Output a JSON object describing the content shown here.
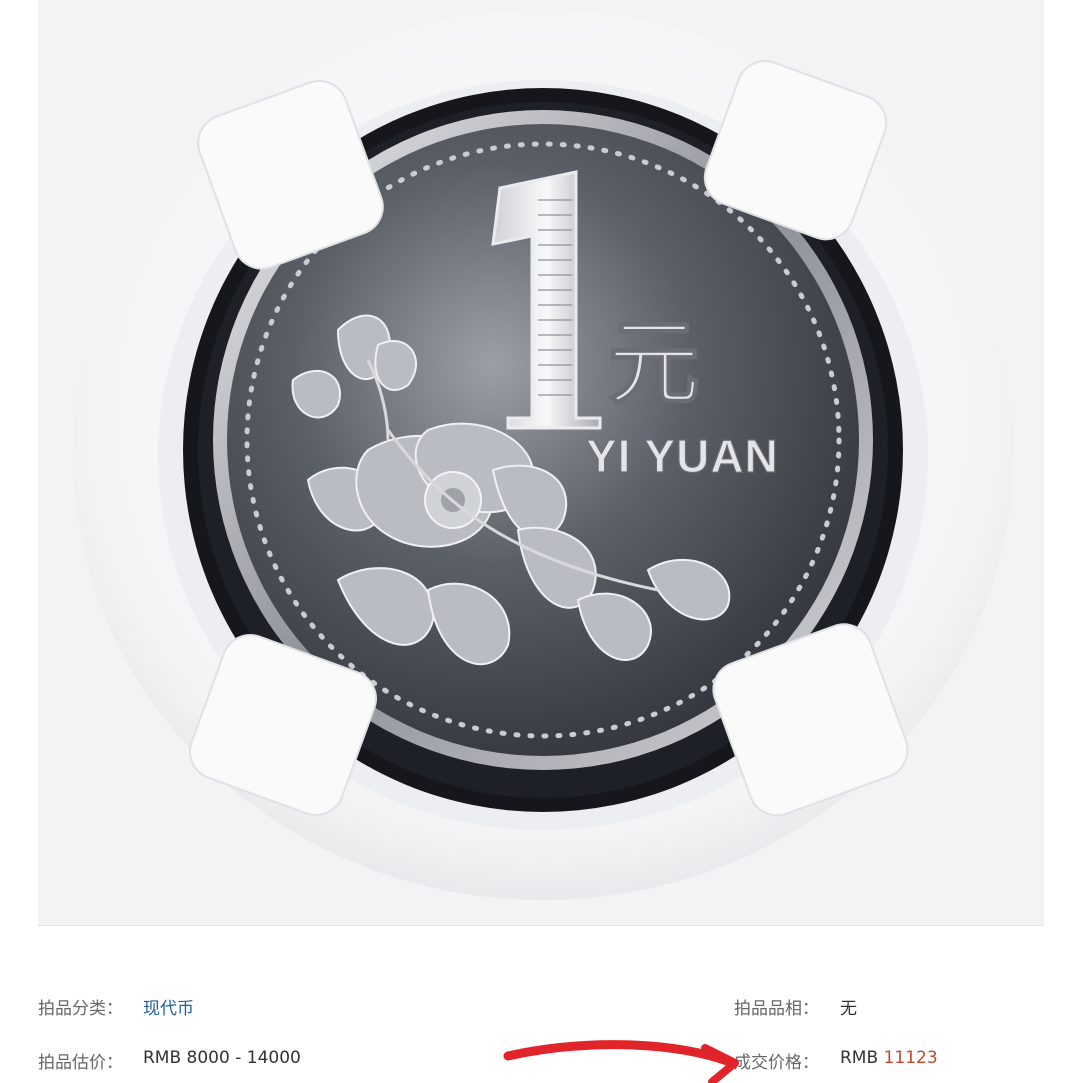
{
  "photo": {
    "coin_numeral": "1",
    "coin_char": "元",
    "coin_legend": "YI YUAN"
  },
  "details": {
    "category_label": "拍品分类：",
    "category_value": "现代币",
    "condition_label": "拍品品相：",
    "condition_value": "无",
    "estimate_label": "拍品估价：",
    "estimate_value": "RMB 8000 - 14000",
    "final_label": "成交价格：",
    "final_currency": "RMB",
    "final_value": "11123"
  },
  "colors": {
    "link": "#1f5fa8",
    "price": "#c6472c",
    "annotation": "#e0242a"
  }
}
